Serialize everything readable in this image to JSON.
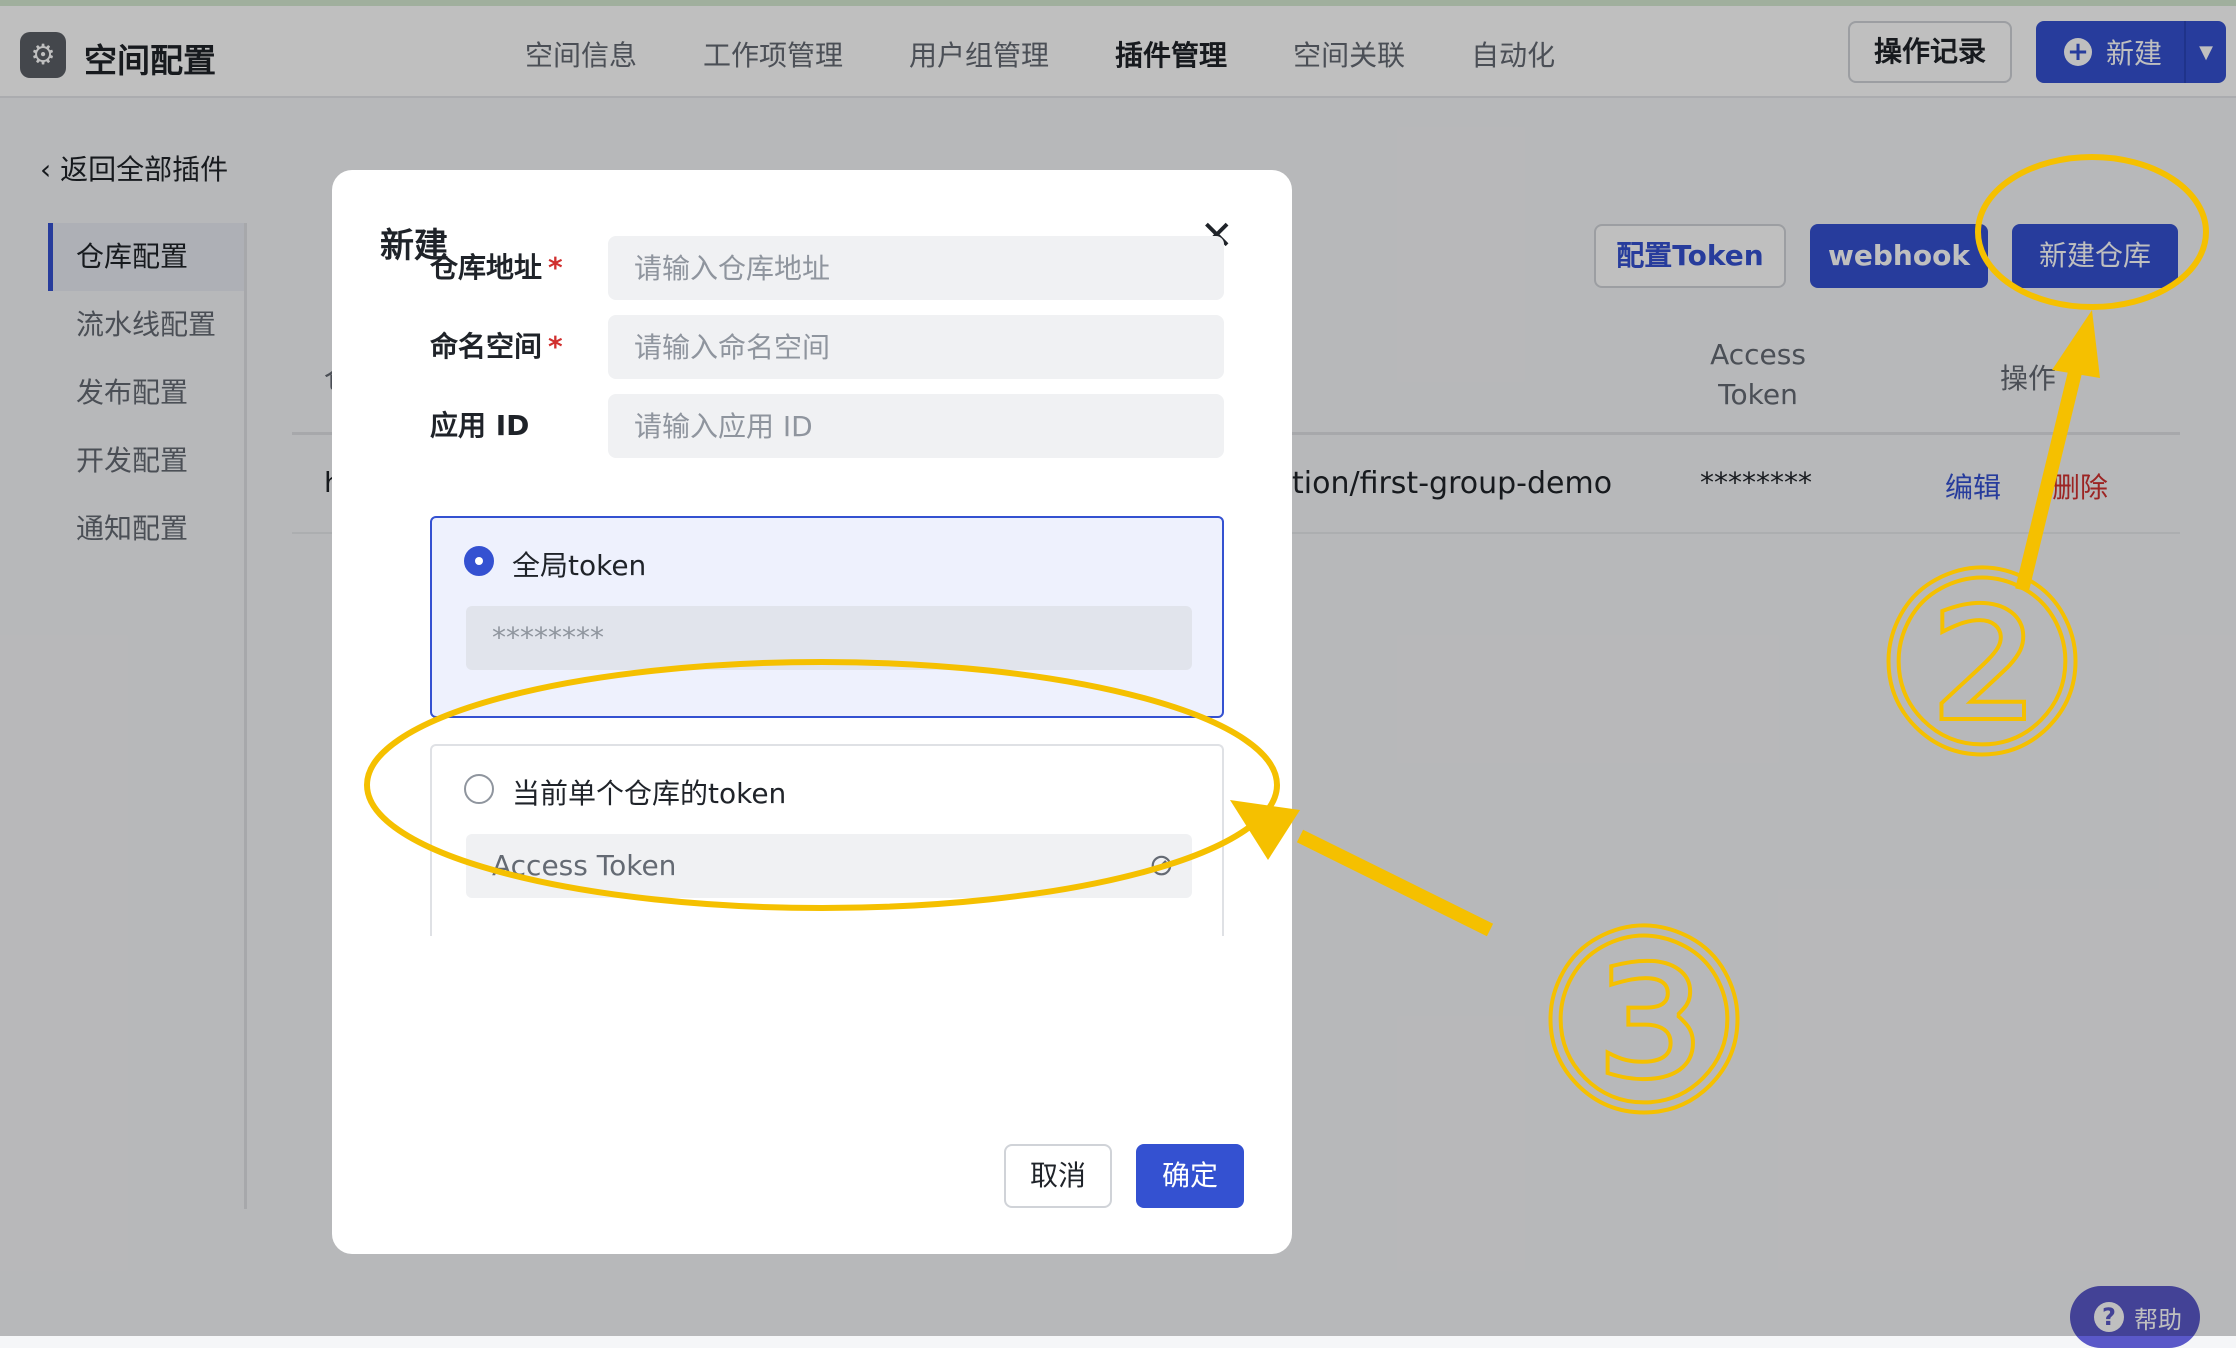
{
  "header": {
    "app_title": "空间配置",
    "nav": [
      "空间信息",
      "工作项管理",
      "用户组管理",
      "插件管理",
      "空间关联",
      "自动化"
    ],
    "active_nav": "插件管理",
    "oplog_label": "操作记录",
    "new_label": "新建"
  },
  "back_label": "返回全部插件",
  "sidebar": {
    "items": [
      {
        "label": "仓库配置",
        "active": true
      },
      {
        "label": "流水线配置"
      },
      {
        "label": "发布配置"
      },
      {
        "label": "开发配置"
      },
      {
        "label": "通知配置"
      }
    ]
  },
  "toolbar": {
    "config_token": "配置Token",
    "webhook": "webhook",
    "new_repo": "新建仓库"
  },
  "table": {
    "headers": {
      "first": "仓",
      "token_line1": "Access",
      "token_line2": "Token",
      "ops": "操作"
    },
    "row": {
      "first": "h",
      "repo": "tion/first-group-demo",
      "token": "********",
      "edit": "编辑",
      "delete": "删除"
    }
  },
  "help_label": "帮助",
  "modal": {
    "title": "新建",
    "fields": [
      {
        "label": "仓库地址",
        "required": true,
        "placeholder": "请输入仓库地址"
      },
      {
        "label": "命名空间",
        "required": true,
        "placeholder": "请输入命名空间"
      },
      {
        "label": "应用 ID",
        "required": false,
        "placeholder": "请输入应用 ID"
      }
    ],
    "required_mark": "*",
    "option_global": {
      "label": "全局token",
      "value": "********",
      "selected": true
    },
    "option_single": {
      "label": "当前单个仓库的token",
      "placeholder": "Access Token",
      "selected": false
    },
    "cancel": "取消",
    "confirm": "确定"
  },
  "annotations": {
    "step2": "②",
    "step3": "③",
    "color": "#f5c000"
  },
  "colors": {
    "primary": "#3451d1",
    "danger": "#d0302f",
    "annotation": "#f5c000"
  }
}
